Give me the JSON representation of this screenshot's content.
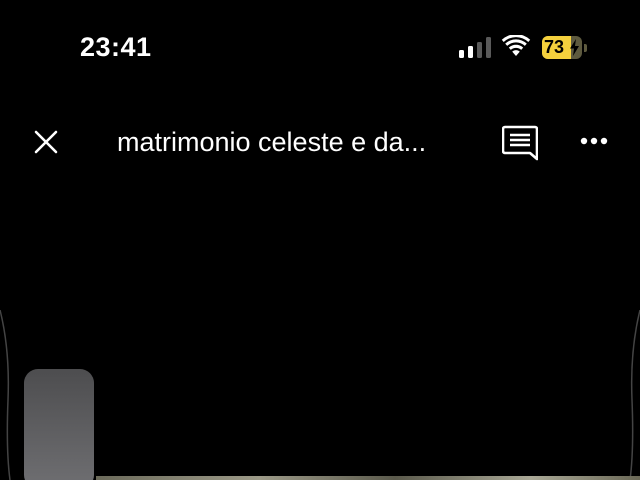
{
  "status_bar": {
    "time": "23:41",
    "battery_level": "73",
    "battery_percent": 73,
    "battery_charging": true,
    "signal_bars_active": 2,
    "signal_bars_total": 4,
    "icons": [
      "signal-icon",
      "wifi-icon",
      "battery-icon",
      "charging-bolt-icon"
    ]
  },
  "header": {
    "title": "matrimonio celeste e da...",
    "icons": [
      "close-icon",
      "comments-icon",
      "more-options-icon"
    ]
  },
  "colors": {
    "background": "#000000",
    "text": "#ffffff",
    "battery_fill": "#f5d13d",
    "scroll_handle": "#5f5f62"
  }
}
